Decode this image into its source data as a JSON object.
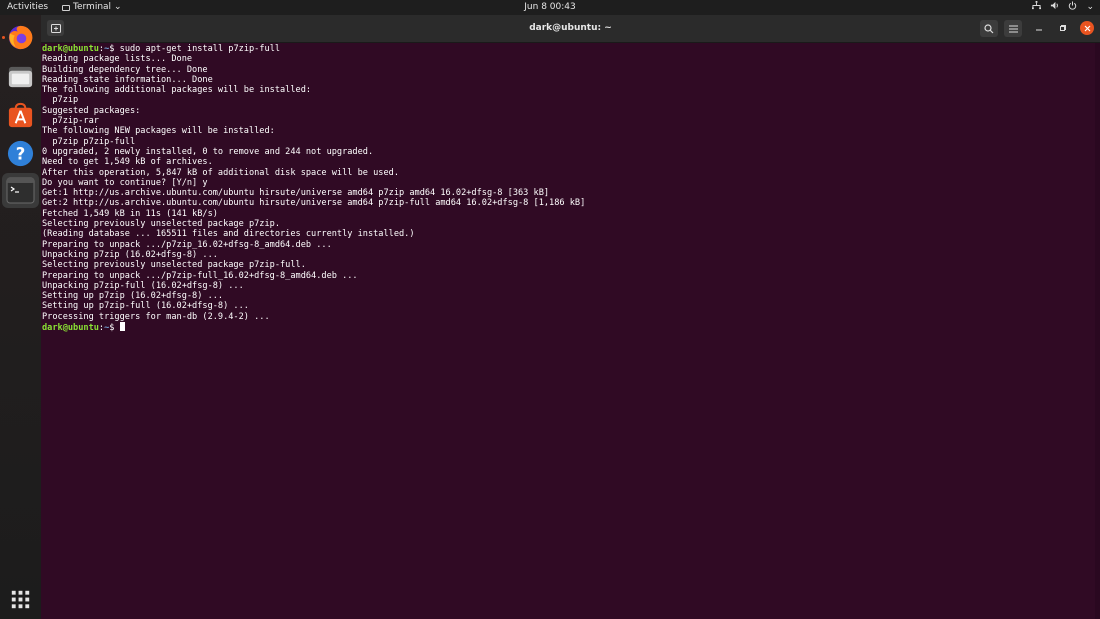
{
  "topbar": {
    "activities": "Activities",
    "app_menu": "Terminal",
    "clock": "Jun 8  00:43"
  },
  "dock": {
    "items": [
      "firefox",
      "files",
      "ubuntu-software",
      "help",
      "terminal",
      "show-applications"
    ]
  },
  "window": {
    "title": "dark@ubuntu: ~"
  },
  "terminal": {
    "prompt_user_host": "dark@ubuntu",
    "prompt_path": "~",
    "command": "sudo apt-get install p7zip-full",
    "output": [
      "Reading package lists... Done",
      "Building dependency tree... Done",
      "Reading state information... Done",
      "The following additional packages will be installed:",
      "  p7zip",
      "Suggested packages:",
      "  p7zip-rar",
      "The following NEW packages will be installed:",
      "  p7zip p7zip-full",
      "0 upgraded, 2 newly installed, 0 to remove and 244 not upgraded.",
      "Need to get 1,549 kB of archives.",
      "After this operation, 5,847 kB of additional disk space will be used.",
      "Do you want to continue? [Y/n] y",
      "Get:1 http://us.archive.ubuntu.com/ubuntu hirsute/universe amd64 p7zip amd64 16.02+dfsg-8 [363 kB]",
      "Get:2 http://us.archive.ubuntu.com/ubuntu hirsute/universe amd64 p7zip-full amd64 16.02+dfsg-8 [1,186 kB]",
      "Fetched 1,549 kB in 11s (141 kB/s)",
      "Selecting previously unselected package p7zip.",
      "(Reading database ... 165511 files and directories currently installed.)",
      "Preparing to unpack .../p7zip_16.02+dfsg-8_amd64.deb ...",
      "Unpacking p7zip (16.02+dfsg-8) ...",
      "Selecting previously unselected package p7zip-full.",
      "Preparing to unpack .../p7zip-full_16.02+dfsg-8_amd64.deb ...",
      "Unpacking p7zip-full (16.02+dfsg-8) ...",
      "Setting up p7zip (16.02+dfsg-8) ...",
      "Setting up p7zip-full (16.02+dfsg-8) ...",
      "Processing triggers for man-db (2.9.4-2) ..."
    ]
  },
  "colors": {
    "terminal_bg": "#300a24",
    "prompt_user": "#8ae234",
    "prompt_path": "#729fcf",
    "accent": "#e95420"
  }
}
